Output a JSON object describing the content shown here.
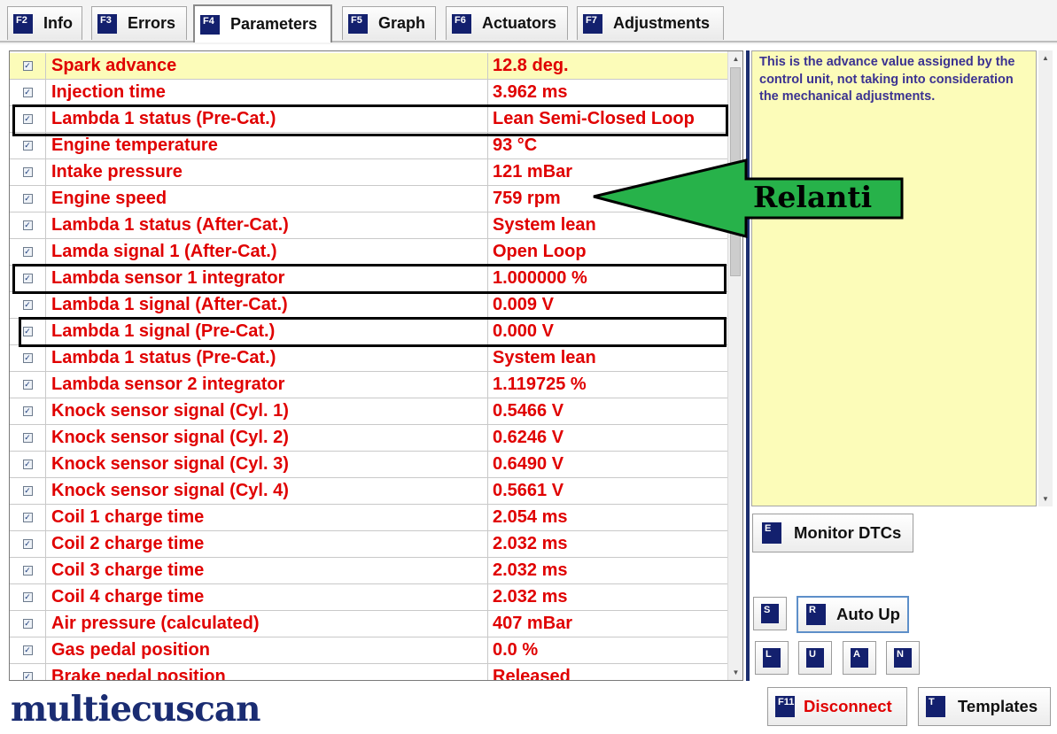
{
  "tabs": [
    {
      "key": "F2",
      "label": "Info"
    },
    {
      "key": "F3",
      "label": "Errors"
    },
    {
      "key": "F4",
      "label": "Parameters",
      "active": true
    },
    {
      "key": "F5",
      "label": "Graph"
    },
    {
      "key": "F6",
      "label": "Actuators"
    },
    {
      "key": "F7",
      "label": "Adjustments"
    }
  ],
  "parameters": [
    {
      "name": "Spark advance",
      "value": "12.8 deg.",
      "checked": true
    },
    {
      "name": "Injection time",
      "value": "3.962 ms",
      "checked": true
    },
    {
      "name": "Lambda 1 status (Pre-Cat.)",
      "value": "Lean Semi-Closed Loop",
      "checked": true
    },
    {
      "name": "Engine temperature",
      "value": "93 °C",
      "checked": true
    },
    {
      "name": "Intake pressure",
      "value": "121 mBar",
      "checked": true
    },
    {
      "name": "Engine speed",
      "value": "759 rpm",
      "checked": true
    },
    {
      "name": "Lambda 1 status (After-Cat.)",
      "value": "System lean",
      "checked": true
    },
    {
      "name": "Lamda signal 1 (After-Cat.)",
      "value": "Open Loop",
      "checked": true
    },
    {
      "name": "Lambda sensor 1 integrator",
      "value": "1.000000 %",
      "checked": true
    },
    {
      "name": "Lambda 1 signal (After-Cat.)",
      "value": "0.009 V",
      "checked": true
    },
    {
      "name": "Lambda 1 signal (Pre-Cat.)",
      "value": "0.000 V",
      "checked": true
    },
    {
      "name": "Lambda 1 status (Pre-Cat.)",
      "value": "System lean",
      "checked": true
    },
    {
      "name": "Lambda sensor 2 integrator",
      "value": "1.119725 %",
      "checked": true
    },
    {
      "name": "Knock sensor signal (Cyl. 1)",
      "value": "0.5466 V",
      "checked": true
    },
    {
      "name": "Knock sensor signal (Cyl. 2)",
      "value": "0.6246 V",
      "checked": true
    },
    {
      "name": "Knock sensor signal (Cyl. 3)",
      "value": "0.6490 V",
      "checked": true
    },
    {
      "name": "Knock sensor signal (Cyl. 4)",
      "value": "0.5661 V",
      "checked": true
    },
    {
      "name": "Coil 1 charge time",
      "value": "2.054 ms",
      "checked": true
    },
    {
      "name": "Coil 2 charge time",
      "value": "2.032 ms",
      "checked": true
    },
    {
      "name": "Coil 3 charge time",
      "value": "2.032 ms",
      "checked": true
    },
    {
      "name": "Coil 4 charge time",
      "value": "2.032 ms",
      "checked": true
    },
    {
      "name": "Air pressure (calculated)",
      "value": "407 mBar",
      "checked": true
    },
    {
      "name": "Gas pedal position",
      "value": "0.0 %",
      "checked": true
    },
    {
      "name": "Brake pedal position",
      "value": "Released",
      "checked": true
    }
  ],
  "description": "This is the advance value assigned by the control unit, not taking into consideration the mechanical adjustments.",
  "buttons": {
    "monitor_dtcs": {
      "key": "E",
      "label": "Monitor DTCs"
    },
    "s": {
      "key": "S"
    },
    "auto_up": {
      "key": "R",
      "label": "Auto Up"
    },
    "l": {
      "key": "L"
    },
    "u": {
      "key": "U"
    },
    "a": {
      "key": "A"
    },
    "n": {
      "key": "N"
    },
    "disconnect": {
      "key": "F11",
      "label": "Disconnect",
      "color": "#e00000"
    },
    "templates": {
      "key": "T",
      "label": "Templates"
    }
  },
  "annotation": {
    "text": "Relanti",
    "fill": "#27b24a"
  },
  "logo": "multiecuscan",
  "colors": {
    "accent": "#13206e",
    "value_red": "#e00000",
    "selected_row": "#fcfcb9",
    "description_text": "#3b3291"
  }
}
